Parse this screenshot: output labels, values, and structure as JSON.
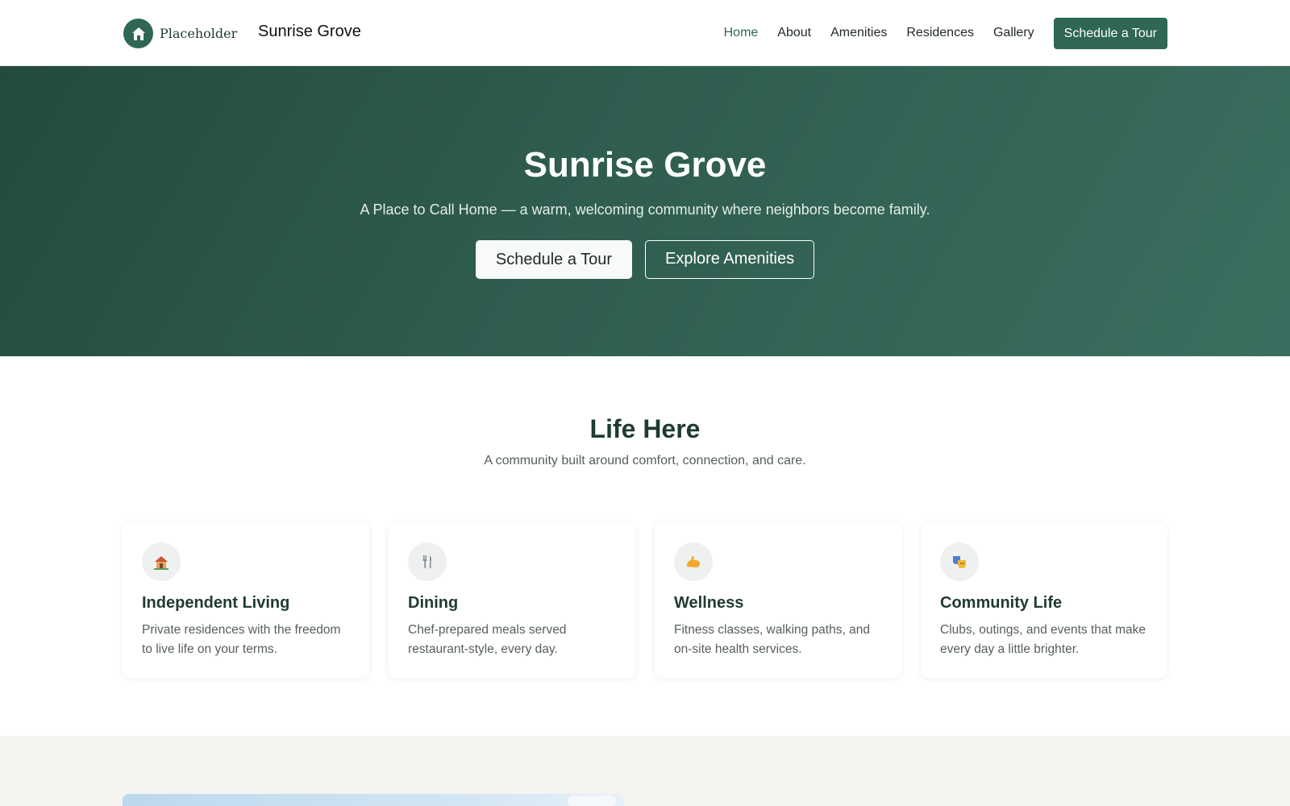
{
  "header": {
    "logo_text": "Placeholder",
    "brand": "Sunrise Grove",
    "nav": [
      "Home",
      "About",
      "Amenities",
      "Residences",
      "Gallery"
    ],
    "active": "Home",
    "cta": "Schedule a Tour"
  },
  "hero": {
    "title": "Sunrise Grove",
    "subtitle": "A Place to Call Home — a warm, welcoming community where neighbors become family.",
    "primary_button": "Schedule a Tour",
    "secondary_button": "Explore Amenities"
  },
  "life": {
    "title": "Life Here",
    "subtitle": "A community built around comfort, connection, and care.",
    "cards": [
      {
        "icon": "house-icon",
        "title": "Independent Living",
        "desc": "Private residences with the freedom to live life on your terms."
      },
      {
        "icon": "fork-knife-icon",
        "title": "Dining",
        "desc": "Chef-prepared meals served restaurant-style, every day."
      },
      {
        "icon": "flexed-bicep-icon",
        "title": "Wellness",
        "desc": "Fitness classes, walking paths, and on-site health services."
      },
      {
        "icon": "theater-masks-icon",
        "title": "Community Life",
        "desc": "Clubs, outings, and events that make every day a little brighter."
      }
    ]
  },
  "colors": {
    "brand_green": "#2f6656",
    "hero_dark": "#244a3e",
    "heading": "#1f3b33",
    "bottom_bg": "#f5f4f0"
  }
}
